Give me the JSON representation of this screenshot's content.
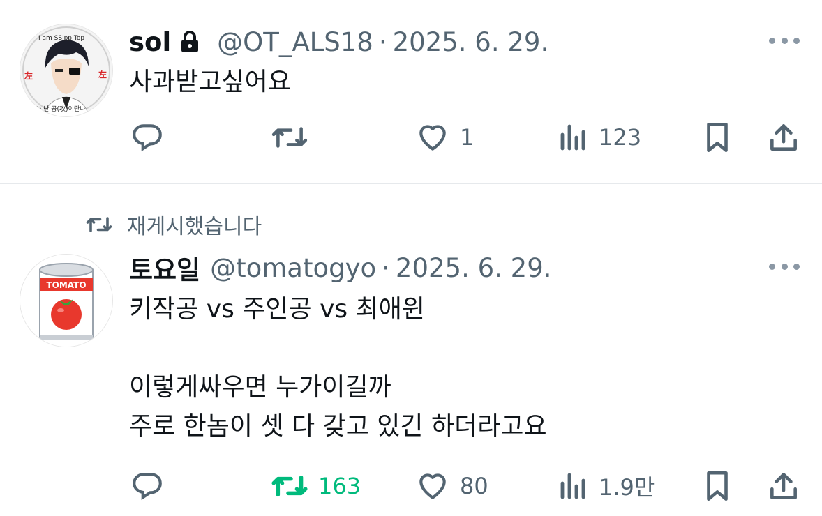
{
  "tweets": [
    {
      "name": "sol",
      "handle": "@OT_ALS18",
      "separator": "·",
      "date": "2025. 6. 29.",
      "text": [
        "사과받고싶어요"
      ],
      "stats": {
        "replies": "",
        "retweets": "",
        "likes": "1",
        "views": "123"
      },
      "avatar_text": {
        "top": "I am SSipp Top",
        "left": "左",
        "right": "左",
        "bottom": "아 난 공(攻)이란나"
      }
    },
    {
      "retweet_label": "재게시했습니다",
      "name": "토요일",
      "handle": "@tomatogyo",
      "separator": "·",
      "date": "2025. 6. 29.",
      "text": [
        "키작공 vs 주인공 vs 최애윈",
        "",
        "이렇게싸우면 누가이길까",
        "주로 한놈이 셋 다 갖고 있긴 하더라고요"
      ],
      "stats": {
        "replies": "",
        "retweets": "163",
        "likes": "80",
        "views": "1.9만"
      },
      "avatar_text": {
        "label": "TOMATO"
      }
    }
  ],
  "icons": [
    "lock-icon",
    "more-icon",
    "reply-icon",
    "retweet-icon",
    "like-icon",
    "views-icon",
    "bookmark-icon",
    "share-icon"
  ],
  "colors": {
    "text": "#0f1419",
    "muted": "#536471",
    "retweet_active": "#00ba7c",
    "divider": "#e6e9ec",
    "tomato_red": "#e8382d"
  }
}
